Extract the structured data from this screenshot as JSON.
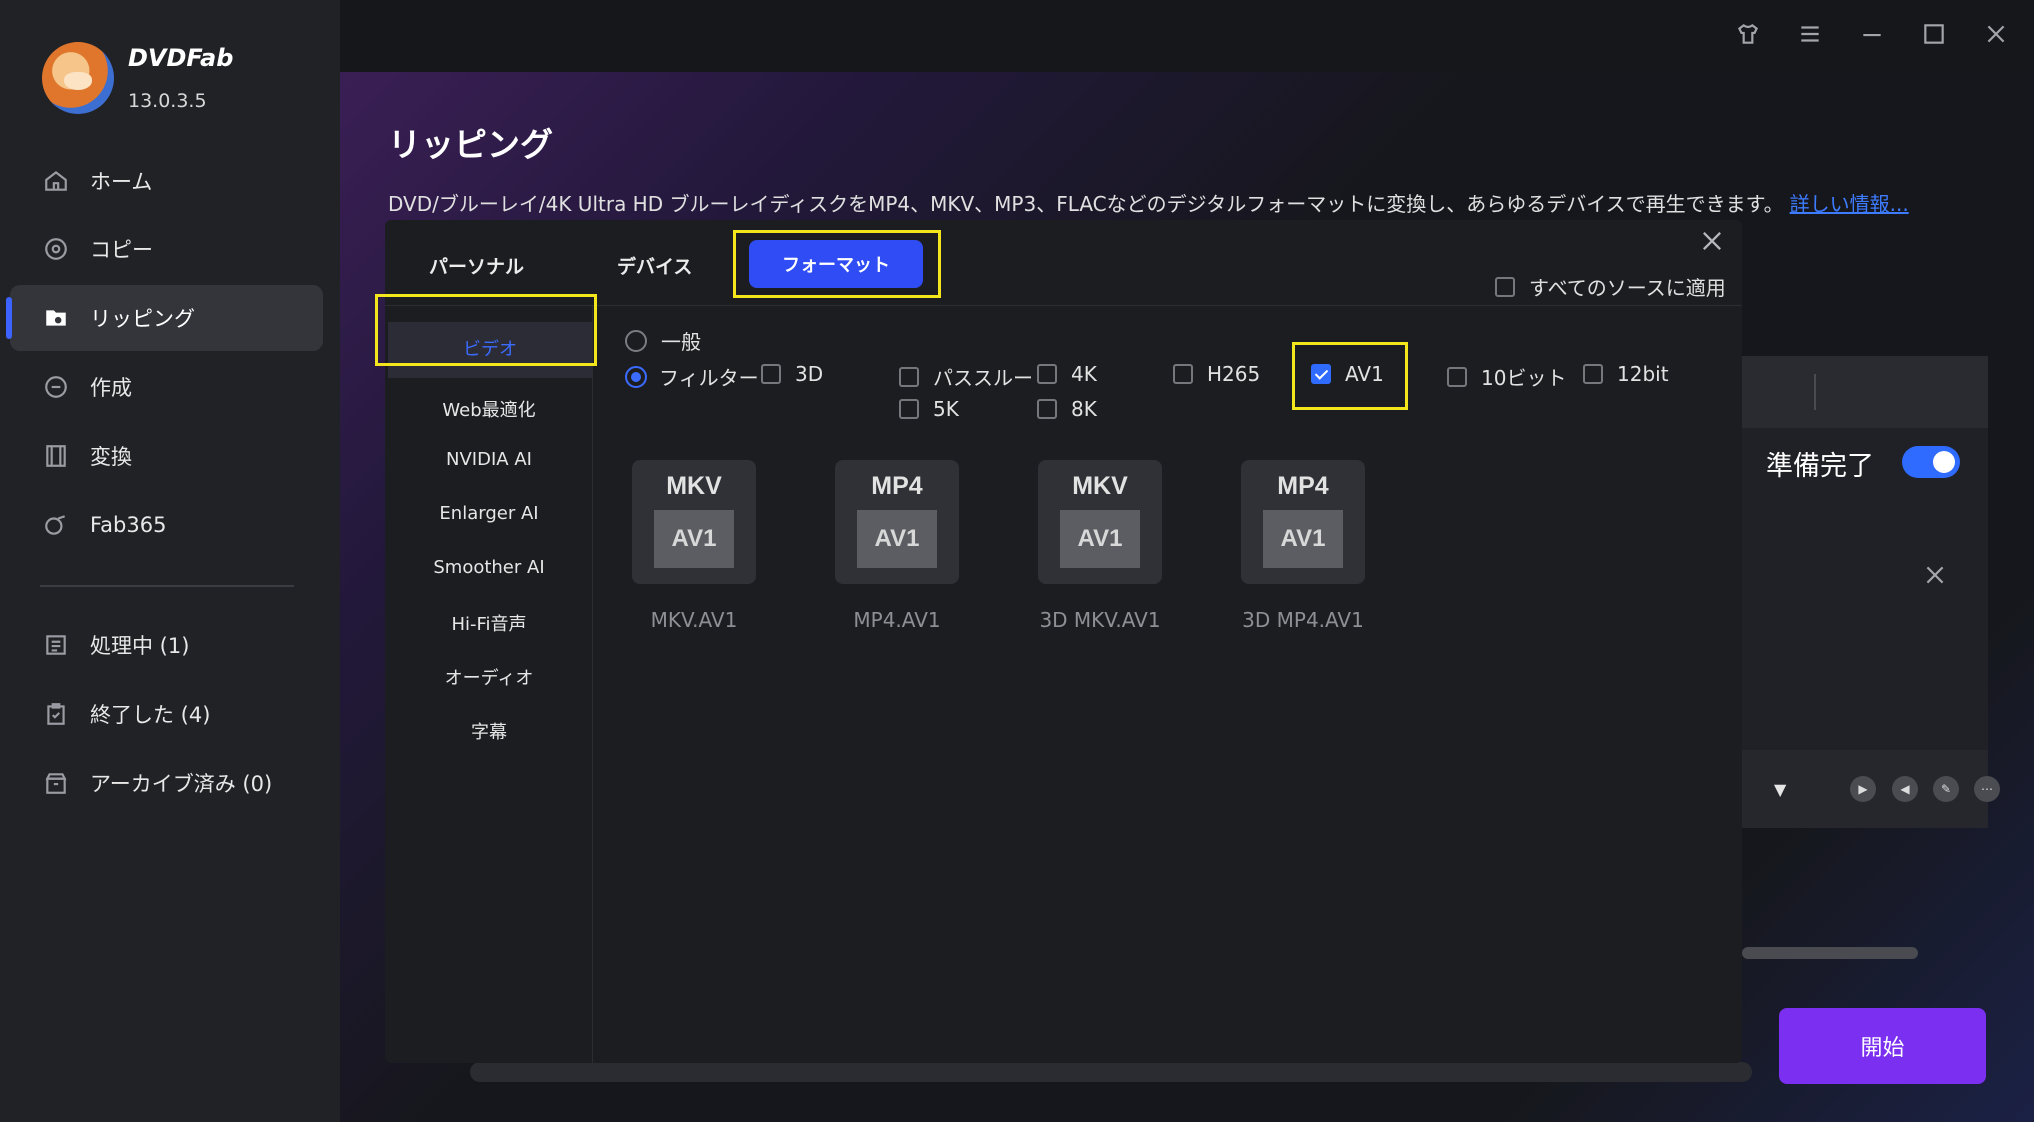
{
  "app": {
    "name": "DVDFab",
    "version": "13.0.3.5"
  },
  "sidebar": {
    "items": [
      {
        "label": "ホーム",
        "icon": "home-icon"
      },
      {
        "label": "コピー",
        "icon": "copy-icon"
      },
      {
        "label": "リッピング",
        "icon": "ripper-icon",
        "active": true
      },
      {
        "label": "作成",
        "icon": "creator-icon"
      },
      {
        "label": "変換",
        "icon": "film-icon"
      },
      {
        "label": "Fab365",
        "icon": "fab365-icon"
      }
    ],
    "queue": [
      {
        "label": "処理中 (1)",
        "icon": "list-icon"
      },
      {
        "label": "終了した (4)",
        "icon": "clipboard-check-icon"
      },
      {
        "label": "アーカイブ済み (0)",
        "icon": "archive-icon"
      }
    ]
  },
  "page": {
    "title": "リッピング",
    "description": "DVD/ブルーレイ/4K Ultra HD ブルーレイディスクをMP4、MKV、MP3、FLACなどのデジタルフォーマットに変換し、あらゆるデバイスで再生できます。",
    "more_link": "詳しい情報..."
  },
  "dialog": {
    "tabs": [
      "パーソナル",
      "デバイス",
      "フォーマット"
    ],
    "active_tab": "フォーマット",
    "apply_all": {
      "label": "すべてのソースに適用",
      "checked": false
    },
    "categories": [
      "ビデオ",
      "Web最適化",
      "NVIDIA AI",
      "Enlarger AI",
      "Smoother AI",
      "Hi-Fi音声",
      "オーディオ",
      "字幕"
    ],
    "active_category": "ビデオ",
    "modes": {
      "general": "一般",
      "filter": "フィルター",
      "selected": "フィルター"
    },
    "filters": [
      {
        "label": "3D",
        "checked": false
      },
      {
        "label": "パススルー",
        "checked": false
      },
      {
        "label": "4K",
        "checked": false
      },
      {
        "label": "H265",
        "checked": false
      },
      {
        "label": "AV1",
        "checked": true
      },
      {
        "label": "10ビット",
        "checked": false
      },
      {
        "label": "12bit",
        "checked": false
      },
      {
        "label": "5K",
        "checked": false
      },
      {
        "label": "8K",
        "checked": false
      }
    ],
    "formats": [
      {
        "top": "MKV",
        "bottom": "AV1",
        "label": "MKV.AV1"
      },
      {
        "top": "MP4",
        "bottom": "AV1",
        "label": "MP4.AV1"
      },
      {
        "top": "MKV",
        "bottom": "AV1",
        "label": "3D MKV.AV1"
      },
      {
        "top": "MP4",
        "bottom": "AV1",
        "label": "3D MP4.AV1"
      }
    ]
  },
  "task": {
    "status": "準備完了",
    "enabled": true
  },
  "start_button": "開始",
  "colors": {
    "accent": "#2f4cf5",
    "start": "#7b2ff0",
    "highlight": "#f4e61c",
    "link": "#3d7bff"
  }
}
